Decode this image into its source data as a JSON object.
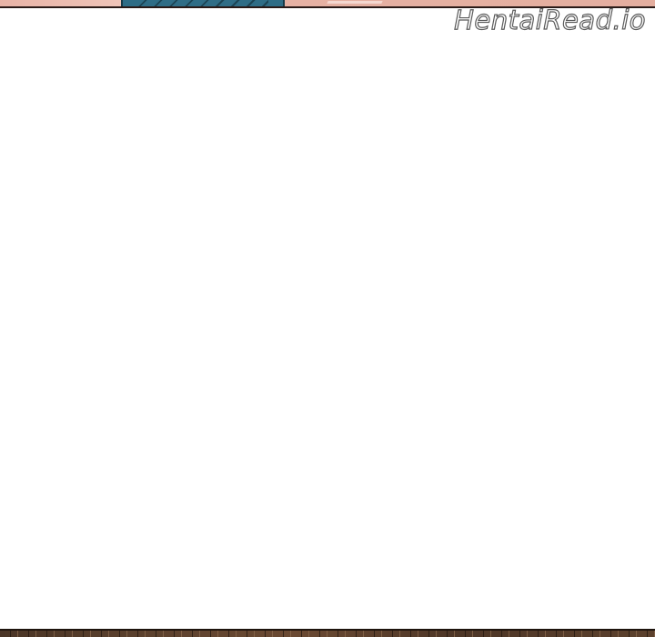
{
  "page": {
    "watermark": "HentaiRead.io"
  },
  "colors": {
    "background": "#ffffff",
    "top_panel_skin": "#e8b3a6",
    "top_panel_cloth": "#2f6d86",
    "bottom_panel": "#5a402d",
    "panel_border": "#2a1a17"
  }
}
